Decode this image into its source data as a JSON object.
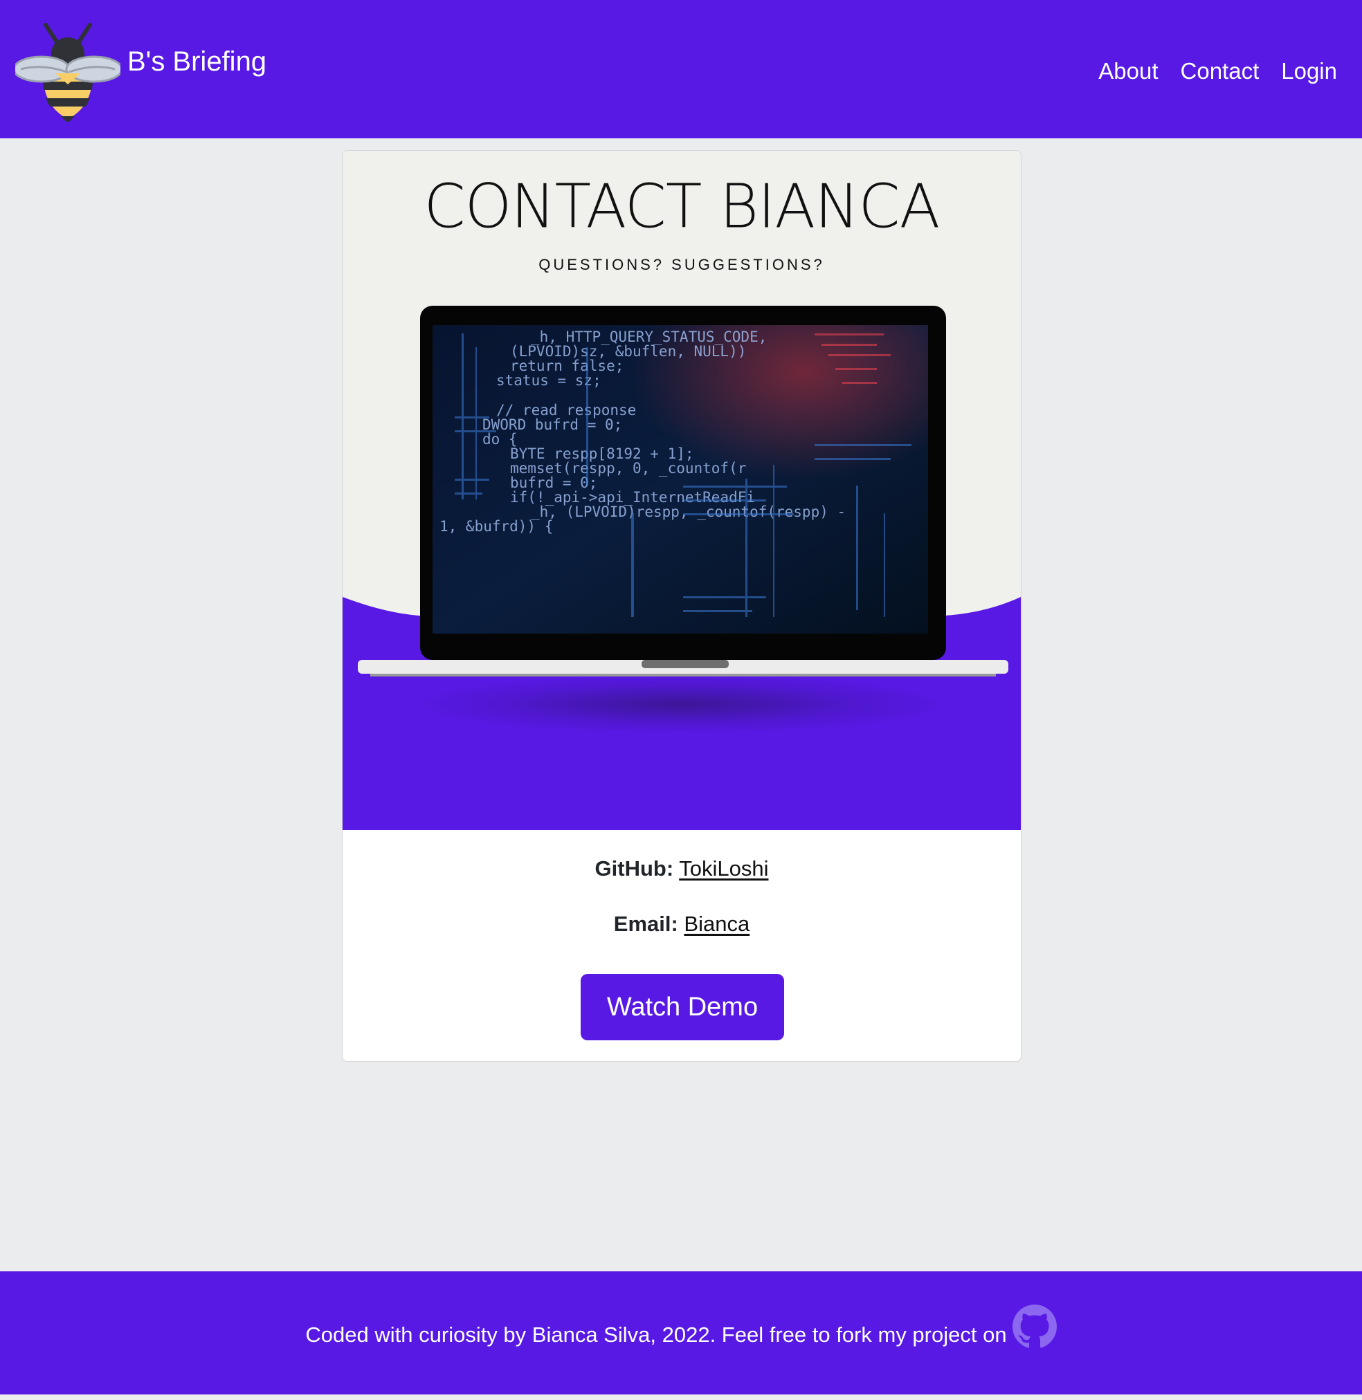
{
  "colors": {
    "brand_purple": "#5719e3",
    "page_background": "#ebecee",
    "hero_background": "#f0f0ed"
  },
  "navbar": {
    "brand_text": "B's Briefing",
    "logo_icon": "bee-icon",
    "links": [
      {
        "label": "About"
      },
      {
        "label": "Contact"
      },
      {
        "label": "Login"
      }
    ]
  },
  "hero": {
    "title": "CONTACT BIANCA",
    "subtitle": "QUESTIONS? SUGGESTIONS?",
    "image_icon": "laptop-code-image",
    "code_lines": [
      "_h, HTTP_QUERY_STATUS_CODE,",
      "(LPVOID)sz, &buflen, NULL))",
      "return false;",
      "status = sz;",
      "// read response",
      "DWORD bufrd = 0;",
      "do {",
      "BYTE respp[8192 + 1];",
      "memset(respp, 0, _countof(r",
      "bufrd = 0;",
      "if(!_api->api_InternetReadFi",
      "_h, (LPVOID)respp, _countof(respp) -",
      "1, &bufrd)) {"
    ]
  },
  "contact": {
    "github_label": "GitHub:",
    "github_value": "TokiLoshi",
    "email_label": "Email:",
    "email_value": "Bianca",
    "demo_button": "Watch Demo"
  },
  "footer": {
    "text": "Coded with curiosity by Bianca Silva, 2022. Feel free to fork my project on",
    "icon": "github-icon"
  }
}
